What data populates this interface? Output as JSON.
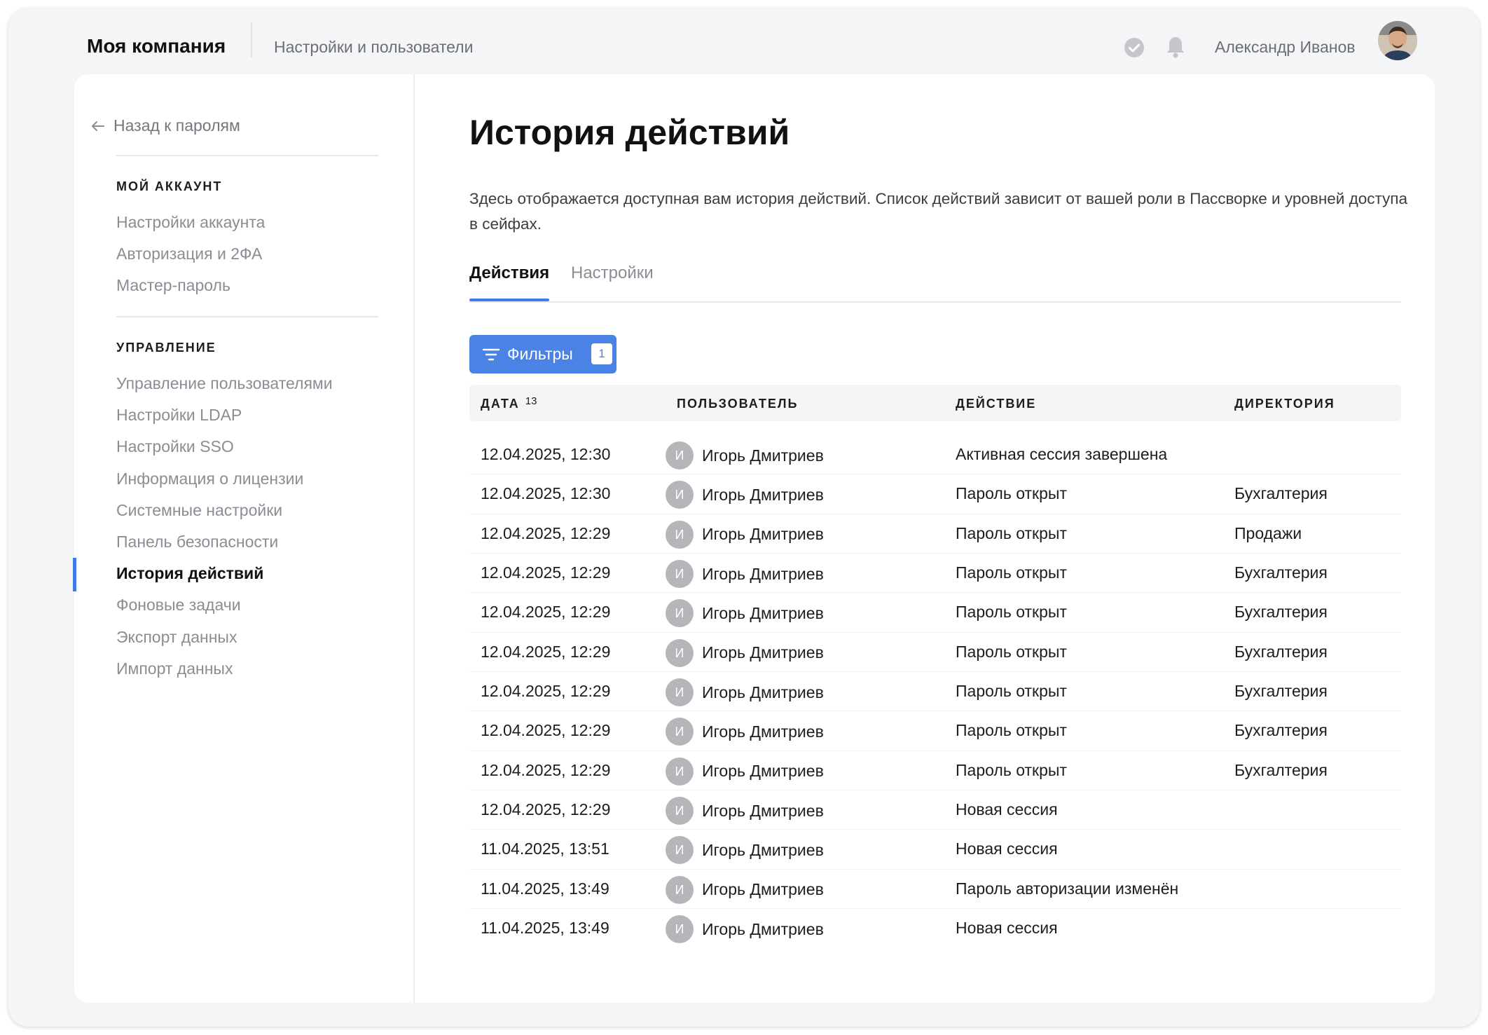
{
  "header": {
    "brand": "Моя компания",
    "section": "Настройки и пользователи",
    "user_name": "Александр Иванов",
    "status_icon": "check-circle-icon",
    "notification_icon": "bell-icon"
  },
  "sidebar": {
    "back_label": "Назад к паролям",
    "groups": [
      {
        "title": "МОЙ АККАУНТ",
        "items": [
          "Настройки аккаунта",
          "Авторизация и 2ФА",
          "Мастер-пароль"
        ]
      },
      {
        "title": "УПРАВЛЕНИЕ",
        "items": [
          "Управление пользователями",
          "Настройки LDAP",
          "Настройки SSO",
          "Информация о лицензии",
          "Системные настройки",
          "Панель безопасности",
          "История действий",
          "Фоновые задачи",
          "Экспорт данных",
          "Импорт данных"
        ],
        "active_index": 6
      }
    ]
  },
  "main": {
    "title": "История действий",
    "description": "Здесь отображается доступная вам история действий. Список действий зависит от вашей роли в Пассворке и уровней доступа в сейфах.",
    "tabs": [
      {
        "label": "Действия",
        "active": true
      },
      {
        "label": "Настройки",
        "active": false
      }
    ],
    "filter_button": {
      "label": "Фильтры",
      "count": "1"
    },
    "table": {
      "columns": [
        "ДАТА",
        "ПОЛЬЗОВАТЕЛЬ",
        "ДЕЙСТВИЕ",
        "ДИРЕКТОРИЯ"
      ],
      "date_sort_indicator": "13",
      "rows": [
        {
          "date": "12.04.2025, 12:30",
          "initial": "И",
          "user": "Игорь Дмитриев",
          "action": "Активная сессия завершена",
          "directory": ""
        },
        {
          "date": "12.04.2025, 12:30",
          "initial": "И",
          "user": "Игорь Дмитриев",
          "action": "Пароль открыт",
          "directory": "Бухгалтерия"
        },
        {
          "date": "12.04.2025, 12:29",
          "initial": "И",
          "user": "Игорь Дмитриев",
          "action": "Пароль открыт",
          "directory": "Продажи"
        },
        {
          "date": "12.04.2025, 12:29",
          "initial": "И",
          "user": "Игорь Дмитриев",
          "action": "Пароль открыт",
          "directory": "Бухгалтерия"
        },
        {
          "date": "12.04.2025, 12:29",
          "initial": "И",
          "user": "Игорь Дмитриев",
          "action": "Пароль открыт",
          "directory": "Бухгалтерия"
        },
        {
          "date": "12.04.2025, 12:29",
          "initial": "И",
          "user": "Игорь Дмитриев",
          "action": "Пароль открыт",
          "directory": "Бухгалтерия"
        },
        {
          "date": "12.04.2025, 12:29",
          "initial": "И",
          "user": "Игорь Дмитриев",
          "action": "Пароль открыт",
          "directory": "Бухгалтерия"
        },
        {
          "date": "12.04.2025, 12:29",
          "initial": "И",
          "user": "Игорь Дмитриев",
          "action": "Пароль открыт",
          "directory": "Бухгалтерия"
        },
        {
          "date": "12.04.2025, 12:29",
          "initial": "И",
          "user": "Игорь Дмитриев",
          "action": "Пароль открыт",
          "directory": "Бухгалтерия"
        },
        {
          "date": "12.04.2025, 12:29",
          "initial": "И",
          "user": "Игорь Дмитриев",
          "action": "Новая сессия",
          "directory": ""
        },
        {
          "date": "11.04.2025, 13:51",
          "initial": "И",
          "user": "Игорь Дмитриев",
          "action": "Новая сессия",
          "directory": ""
        },
        {
          "date": "11.04.2025, 13:49",
          "initial": "И",
          "user": "Игорь Дмитриев",
          "action": "Пароль авторизации изменён",
          "directory": ""
        },
        {
          "date": "11.04.2025, 13:49",
          "initial": "И",
          "user": "Игорь Дмитриев",
          "action": "Новая сессия",
          "directory": ""
        }
      ]
    }
  },
  "colors": {
    "accent": "#4b82e6",
    "active_indicator": "#3e7be6",
    "background": "#f4f5f7",
    "card": "#ffffff"
  }
}
